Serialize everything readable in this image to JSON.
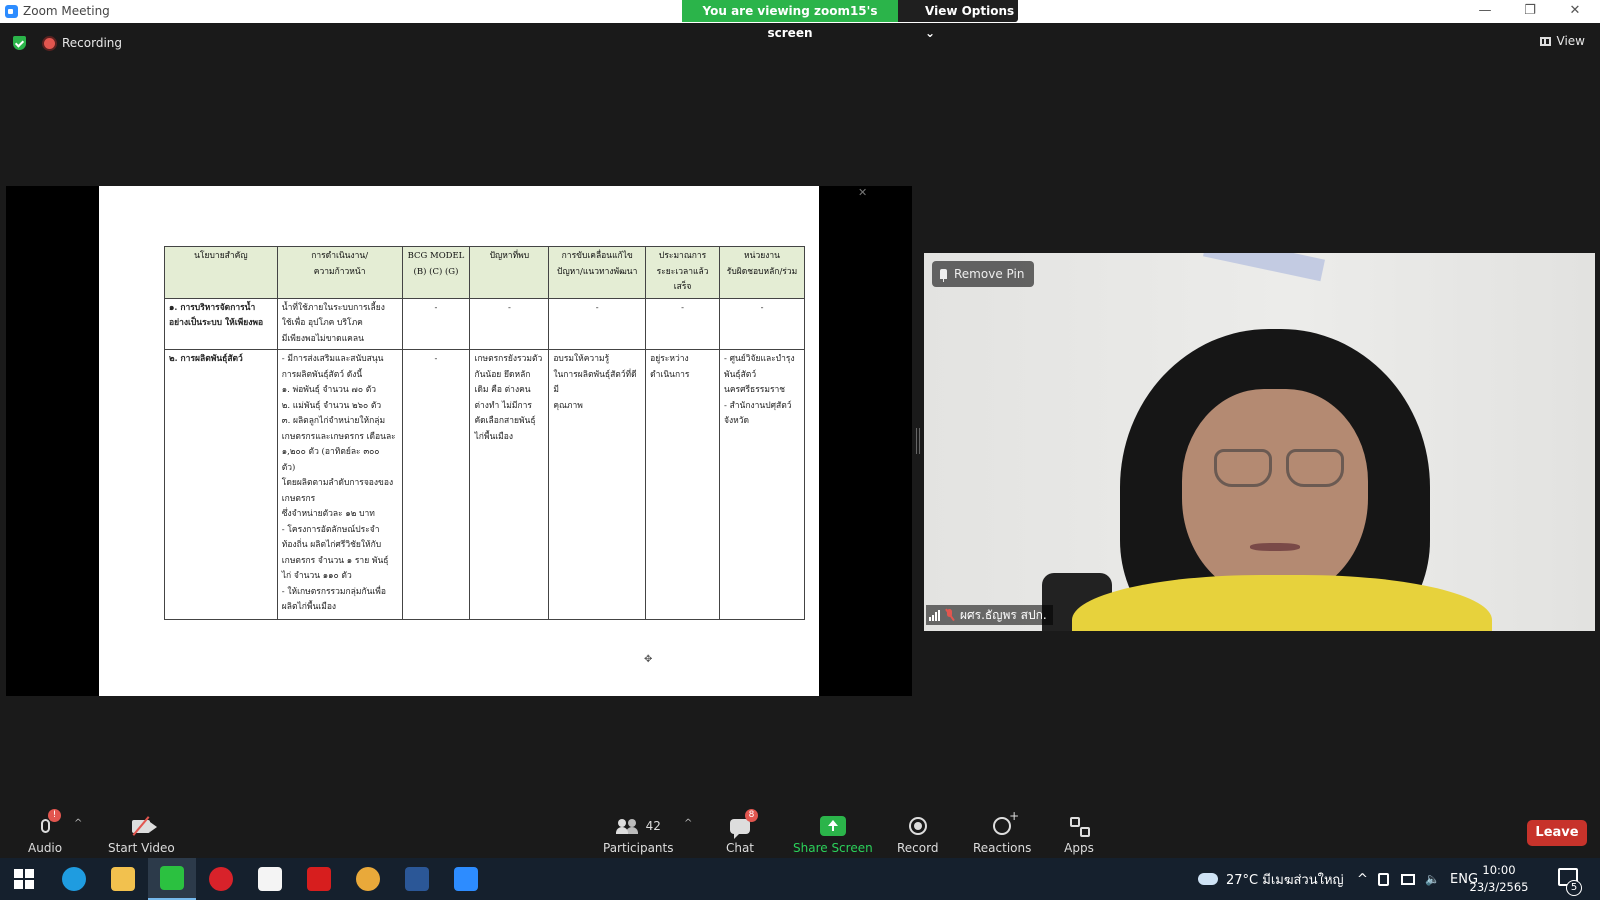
{
  "window": {
    "title": "Zoom Meeting",
    "viewing_banner": "You are viewing zoom15's screen",
    "view_options": "View Options",
    "view_options_chevron": "⌄",
    "minimize": "—",
    "maximize": "❐",
    "close": "✕"
  },
  "status": {
    "recording_label": "Recording",
    "view_label": "View"
  },
  "shared_doc": {
    "headers": [
      "นโยบายสำคัญ",
      "การดำเนินงาน/\nความก้าวหน้า",
      "BCG MODEL\n(B) (C) (G)",
      "ปัญหาที่พบ",
      "การขับเคลื่อนแก้ไข\nปัญหา/แนวทางพัฒนา",
      "ประมาณการ\nระยะเวลาแล้ว\nเสร็จ",
      "หน่วยงาน\nรับผิดชอบหลัก/ร่วม"
    ],
    "rows": [
      {
        "policy": "๑. การบริหารจัดการน้ำ\nอย่างเป็นระบบ ให้เพียงพอ",
        "progress": "น้ำที่ใช้ภายในระบบการเลี้ยง\nใช้เพื่อ อุปโภค บริโภค\nมีเพียงพอไม่ขาดแคลน",
        "bcg": "-",
        "problem": "-",
        "solution": "-",
        "timeline": "-",
        "agency": "-"
      },
      {
        "policy": "๒. การผลิตพันธุ์สัตว์",
        "progress": "- มีการส่งเสริมและสนับสนุน\nการผลิตพันธุ์สัตว์ ดังนี้\n๑. พ่อพันธุ์ จำนวน ๗๐ ตัว\n๒. แม่พันธุ์ จำนวน ๒๖๐ ตัว\n๓. ผลิตลูกไก่จำหน่ายให้กลุ่ม\nเกษตรกรและเกษตรกร เดือนละ\n๑,๒๐๐ ตัว (อาทิตย์ละ ๓๐๐\nตัว)\nโดยผลิตตามลำดับการจองของ\nเกษตรกร\nซึ่งจำหน่ายตัวละ ๑๒ บาท\n- โครงการอัตลักษณ์ประจำ\nท้องถิ่น ผลิตไก่ศรีวิชัยให้กับ\nเกษตรกร จำนวน ๑ ราย พันธุ์\nไก่ จำนวน ๑๑๐ ตัว\n- ให้เกษตรกรรวมกลุ่มกันเพื่อ\nผลิตไก่พื้นเมือง",
        "bcg": "-",
        "problem": "เกษตรกรยังรวมตัว\nกันน้อย ยึดหลัก\nเดิม คือ ต่างคน\nต่างทำ ไม่มีการ\nคัดเลือกสายพันธุ์\nไก่พื้นเมือง",
        "solution": "อบรมให้ความรู้\nในการผลิตพันธุ์สัตว์ที่ดีมี\nคุณภาพ",
        "timeline": "อยู่ระหว่าง\nดำเนินการ",
        "agency": "- ศูนย์วิจัยและบำรุง\nพันธุ์สัตว์\nนครศรีธรรมราช\n- สำนักงานปศุสัตว์\nจังหวัด"
      }
    ]
  },
  "video": {
    "remove_pin": "Remove Pin",
    "participant_name": "ผศร.ธัญพร สปก."
  },
  "toolbar": {
    "audio": "Audio",
    "audio_badge": "!",
    "start_video": "Start Video",
    "participants": "Participants",
    "participants_count": "42",
    "chat": "Chat",
    "chat_badge": "8",
    "share_screen": "Share Screen",
    "record": "Record",
    "reactions": "Reactions",
    "apps": "Apps",
    "leave": "Leave",
    "caret": "^"
  },
  "taskbar": {
    "weather": "27°C มีเมฆส่วนใหญ่",
    "tray_chevron": "^",
    "language": "ENG",
    "time": "10:00",
    "date": "23/3/2565",
    "notification_count": "5",
    "apps": [
      {
        "name": "edge",
        "color": "#1f9ce0"
      },
      {
        "name": "file-explorer",
        "color": "#f2c14e"
      },
      {
        "name": "line",
        "color": "#2bc140"
      },
      {
        "name": "opera",
        "color": "#d8222a"
      },
      {
        "name": "document",
        "color": "#f4f4f4"
      },
      {
        "name": "acrobat",
        "color": "#d71e1e"
      },
      {
        "name": "chrome",
        "color": "#e9a93a"
      },
      {
        "name": "word",
        "color": "#2b5797"
      },
      {
        "name": "zoom",
        "color": "#2d8cff"
      }
    ]
  },
  "colors": {
    "banner_green": "#2bb44a",
    "leave_red": "#c7332b",
    "table_header": "#e4edd4"
  }
}
